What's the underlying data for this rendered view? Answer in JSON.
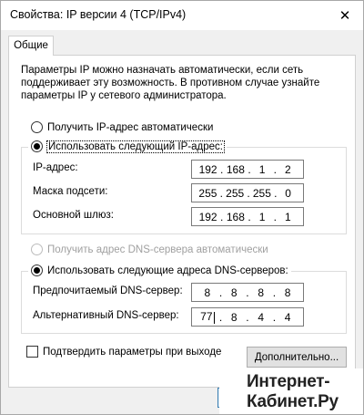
{
  "window": {
    "title": "Свойства: IP версии 4 (TCP/IPv4)",
    "close_glyph": "✕"
  },
  "tabs": [
    {
      "label": "Общие",
      "active": true
    }
  ],
  "intro_text": "Параметры IP можно назначать автоматически, если сеть поддерживает эту возможность. В противном случае узнайте параметры IP у сетевого администратора.",
  "ip_mode": {
    "auto_label": "Получить IP-адрес автоматически",
    "manual_label": "Использовать следующий IP-адрес:",
    "selected": "manual"
  },
  "ip_fields": [
    {
      "label": "IP-адрес:",
      "octets": [
        "192",
        "168",
        "1",
        "2"
      ]
    },
    {
      "label": "Маска подсети:",
      "octets": [
        "255",
        "255",
        "255",
        "0"
      ]
    },
    {
      "label": "Основной шлюз:",
      "octets": [
        "192",
        "168",
        "1",
        "1"
      ]
    }
  ],
  "dns_mode": {
    "auto_label": "Получить адрес DNS-сервера автоматически",
    "manual_label": "Использовать следующие адреса DNS-серверов:",
    "selected": "manual"
  },
  "dns_fields": [
    {
      "label": "Предпочитаемый DNS-сервер:",
      "octets": [
        "8",
        "8",
        "8",
        "8"
      ]
    },
    {
      "label": "Альтернативный DNS-сервер:",
      "octets": [
        "77",
        "8",
        "4",
        "4"
      ]
    }
  ],
  "validate_on_exit": {
    "label": "Подтвердить параметры при выходе",
    "checked": false
  },
  "advanced_button": "Дополнительно...",
  "watermark": {
    "line1": "Интернет-",
    "line2": "Кабинет.Ру"
  }
}
